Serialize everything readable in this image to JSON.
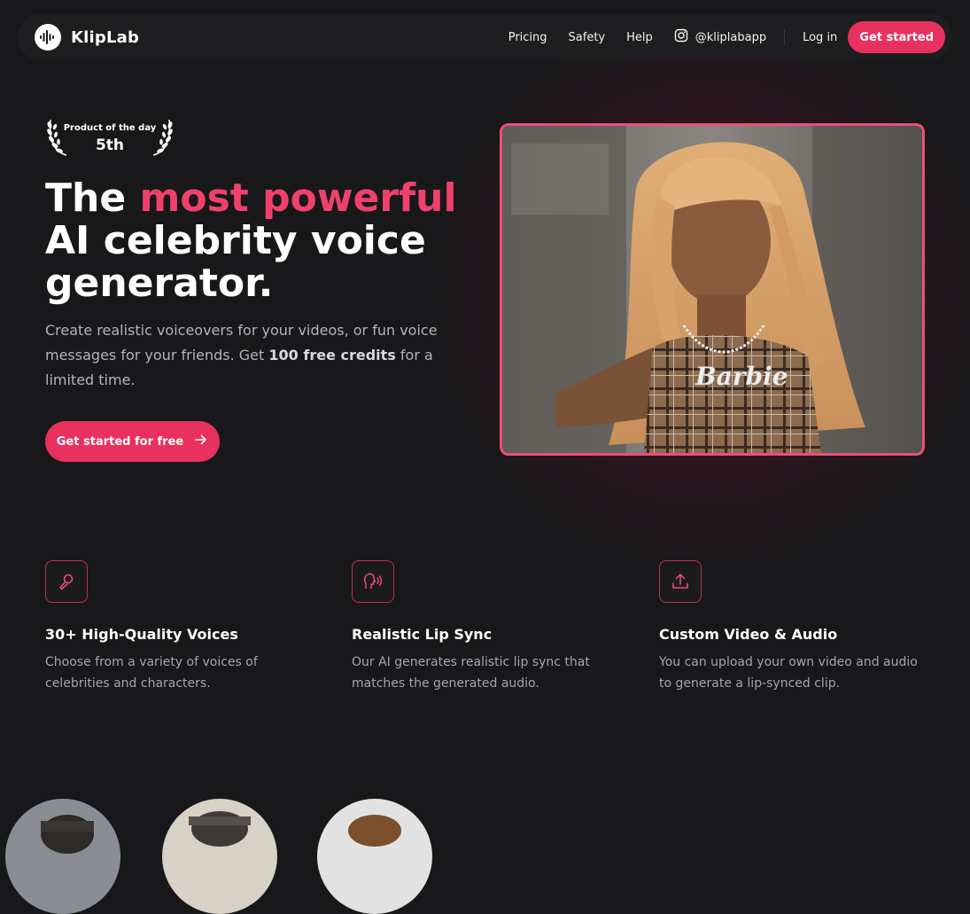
{
  "brand": {
    "name": "KlipLab"
  },
  "nav": {
    "links": [
      "Pricing",
      "Safety",
      "Help"
    ],
    "instagram_handle": "@kliplabapp",
    "login": "Log in",
    "cta": "Get started"
  },
  "badge": {
    "line1": "Product of the day",
    "line2": "5th"
  },
  "hero": {
    "headline_pre": "The ",
    "headline_accent": "most powerful",
    "headline_post": "AI celebrity voice generator.",
    "sub_pre": "Create realistic voiceovers for your videos, or fun voice messages for your friends. Get ",
    "sub_strong": "100 free credits",
    "sub_post": " for a limited time.",
    "cta": "Get started for free",
    "necklace_text": "Barbie"
  },
  "features": [
    {
      "icon": "microphone-icon",
      "title": "30+ High-Quality Voices",
      "desc": "Choose from a variety of voices of celebrities and characters."
    },
    {
      "icon": "speaking-head-icon",
      "title": "Realistic Lip Sync",
      "desc": "Our AI generates realistic lip sync that matches the generated audio."
    },
    {
      "icon": "upload-icon",
      "title": "Custom Video & Audio",
      "desc": "You can upload your own video and audio to generate a lip-synced clip."
    }
  ],
  "colors": {
    "accent": "#e8315f",
    "accent_text": "#f0416b",
    "background": "#18181a"
  }
}
